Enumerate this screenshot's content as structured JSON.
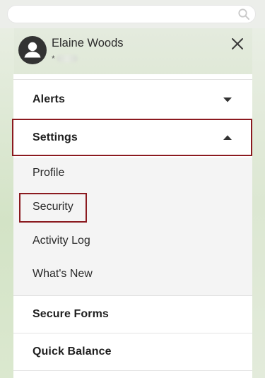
{
  "search": {
    "placeholder": "",
    "value": ""
  },
  "user": {
    "name": "Elaine Woods",
    "account_prefix": "*"
  },
  "menu": {
    "alerts": "Alerts",
    "settings": "Settings",
    "settings_items": [
      "Profile",
      "Security",
      "Activity Log",
      "What's New"
    ],
    "secure_forms": "Secure Forms",
    "quick_balance": "Quick Balance"
  },
  "colors": {
    "highlight": "#8b1a1f",
    "text": "#1e1e1e",
    "submenu_bg": "#f4f4f4"
  },
  "icons": {
    "search": "search-icon",
    "avatar": "user-avatar-icon",
    "close": "close-icon",
    "expand": "chevron-down-icon",
    "collapse": "chevron-up-icon"
  }
}
